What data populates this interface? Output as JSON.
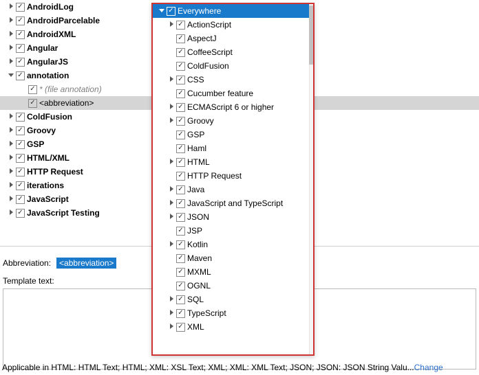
{
  "leftTree": [
    {
      "label": "AndroidLog",
      "expand": "right",
      "bold": true,
      "indent": 0
    },
    {
      "label": "AndroidParcelable",
      "expand": "right",
      "bold": true,
      "indent": 0
    },
    {
      "label": "AndroidXML",
      "expand": "right",
      "bold": true,
      "indent": 0
    },
    {
      "label": "Angular",
      "expand": "right",
      "bold": true,
      "indent": 0
    },
    {
      "label": "AngularJS",
      "expand": "right",
      "bold": true,
      "indent": 0
    },
    {
      "label": "annotation",
      "expand": "down",
      "bold": true,
      "indent": 0
    },
    {
      "label": "* (file annotation)",
      "expand": "",
      "bold": false,
      "italic": true,
      "indent": 1
    },
    {
      "label": "<abbreviation>",
      "expand": "",
      "bold": false,
      "indent": 1,
      "selected": true
    },
    {
      "label": "ColdFusion",
      "expand": "right",
      "bold": true,
      "indent": 0
    },
    {
      "label": "Groovy",
      "expand": "right",
      "bold": true,
      "indent": 0
    },
    {
      "label": "GSP",
      "expand": "right",
      "bold": true,
      "indent": 0
    },
    {
      "label": "HTML/XML",
      "expand": "right",
      "bold": true,
      "indent": 0
    },
    {
      "label": "HTTP Request",
      "expand": "right",
      "bold": true,
      "indent": 0
    },
    {
      "label": "iterations",
      "expand": "right",
      "bold": true,
      "indent": 0
    },
    {
      "label": "JavaScript",
      "expand": "right",
      "bold": true,
      "indent": 0
    },
    {
      "label": "JavaScript Testing",
      "expand": "right",
      "bold": true,
      "indent": 0
    }
  ],
  "popup": {
    "header": {
      "label": "Everywhere",
      "expand": "down"
    },
    "items": [
      {
        "label": "ActionScript",
        "expand": "right"
      },
      {
        "label": "AspectJ",
        "expand": ""
      },
      {
        "label": "CoffeeScript",
        "expand": ""
      },
      {
        "label": "ColdFusion",
        "expand": ""
      },
      {
        "label": "CSS",
        "expand": "right"
      },
      {
        "label": "Cucumber feature",
        "expand": ""
      },
      {
        "label": "ECMAScript 6 or higher",
        "expand": "right"
      },
      {
        "label": "Groovy",
        "expand": "right"
      },
      {
        "label": "GSP",
        "expand": ""
      },
      {
        "label": "Haml",
        "expand": ""
      },
      {
        "label": "HTML",
        "expand": "right"
      },
      {
        "label": "HTTP Request",
        "expand": ""
      },
      {
        "label": "Java",
        "expand": "right"
      },
      {
        "label": "JavaScript and TypeScript",
        "expand": "right"
      },
      {
        "label": "JSON",
        "expand": "right"
      },
      {
        "label": "JSP",
        "expand": ""
      },
      {
        "label": "Kotlin",
        "expand": "right"
      },
      {
        "label": "Maven",
        "expand": ""
      },
      {
        "label": "MXML",
        "expand": ""
      },
      {
        "label": "OGNL",
        "expand": ""
      },
      {
        "label": "SQL",
        "expand": "right"
      },
      {
        "label": "TypeScript",
        "expand": "right"
      },
      {
        "label": "XML",
        "expand": "right"
      }
    ]
  },
  "form": {
    "abbr_label": "Abbreviation:",
    "abbr_value": "<abbreviation>",
    "tmpl_label": "Template text:"
  },
  "footer": {
    "text": "Applicable in HTML: HTML Text; HTML; XML: XSL Text; XML; XML: XML Text; JSON; JSON: JSON String Valu...",
    "link": "Change"
  }
}
